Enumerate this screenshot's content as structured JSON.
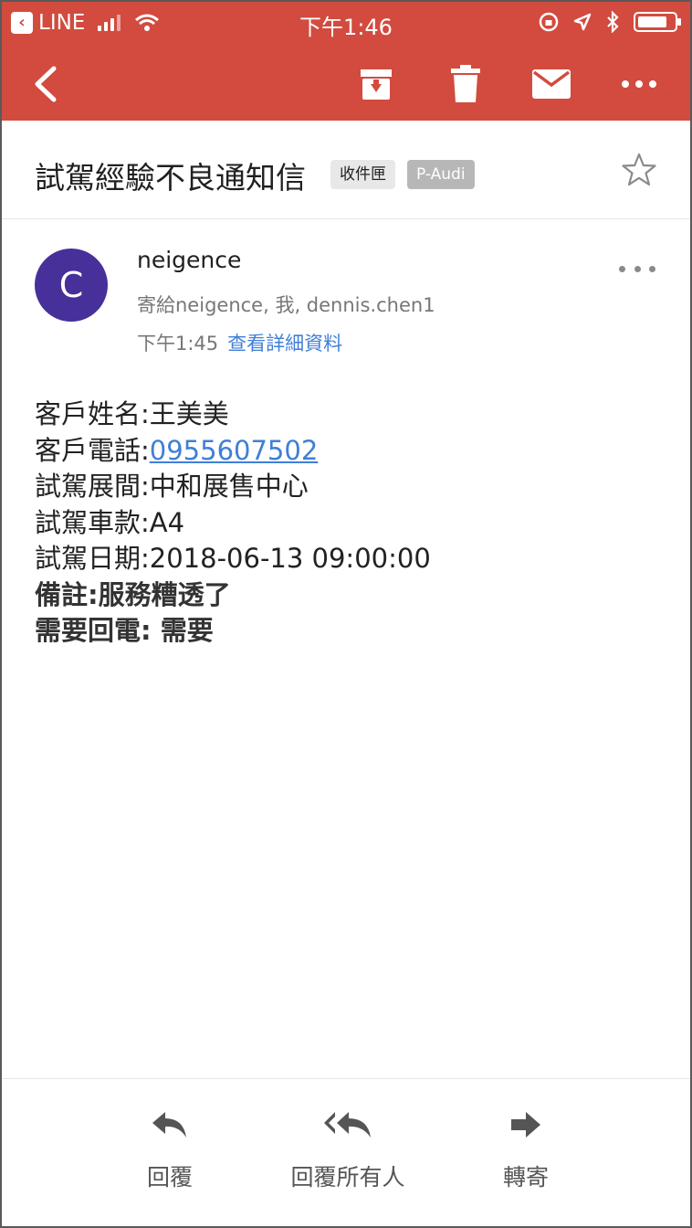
{
  "status_bar": {
    "back_app": "LINE",
    "time": "下午1:46"
  },
  "toolbar": {
    "icons": [
      "back-arrow-icon",
      "archive-icon",
      "trash-icon",
      "mail-icon",
      "more-icon"
    ]
  },
  "email": {
    "subject": "試駕經驗不良通知信",
    "labels": [
      "收件匣",
      "P-Audi"
    ],
    "sender_initial": "C",
    "sender_name": "neigence",
    "recipients": "寄給neigence, 我, dennis.chen1",
    "time": "下午1:45",
    "details_link": "查看詳細資料",
    "body": {
      "line1": "客戶姓名:王美美",
      "line2_prefix": "客戶電話:",
      "phone": "0955607502",
      "line3": "試駕展間:中和展售中心",
      "line4": "試駕車款:A4",
      "line5": "試駕日期:2018-06-13 09:00:00",
      "line6": "備註:服務糟透了",
      "line7": "需要回電: 需要"
    }
  },
  "actions": {
    "reply": "回覆",
    "reply_all": "回覆所有人",
    "forward": "轉寄"
  },
  "colors": {
    "header": "#d24b3e",
    "avatar": "#47309a",
    "link": "#3f7fd8"
  }
}
